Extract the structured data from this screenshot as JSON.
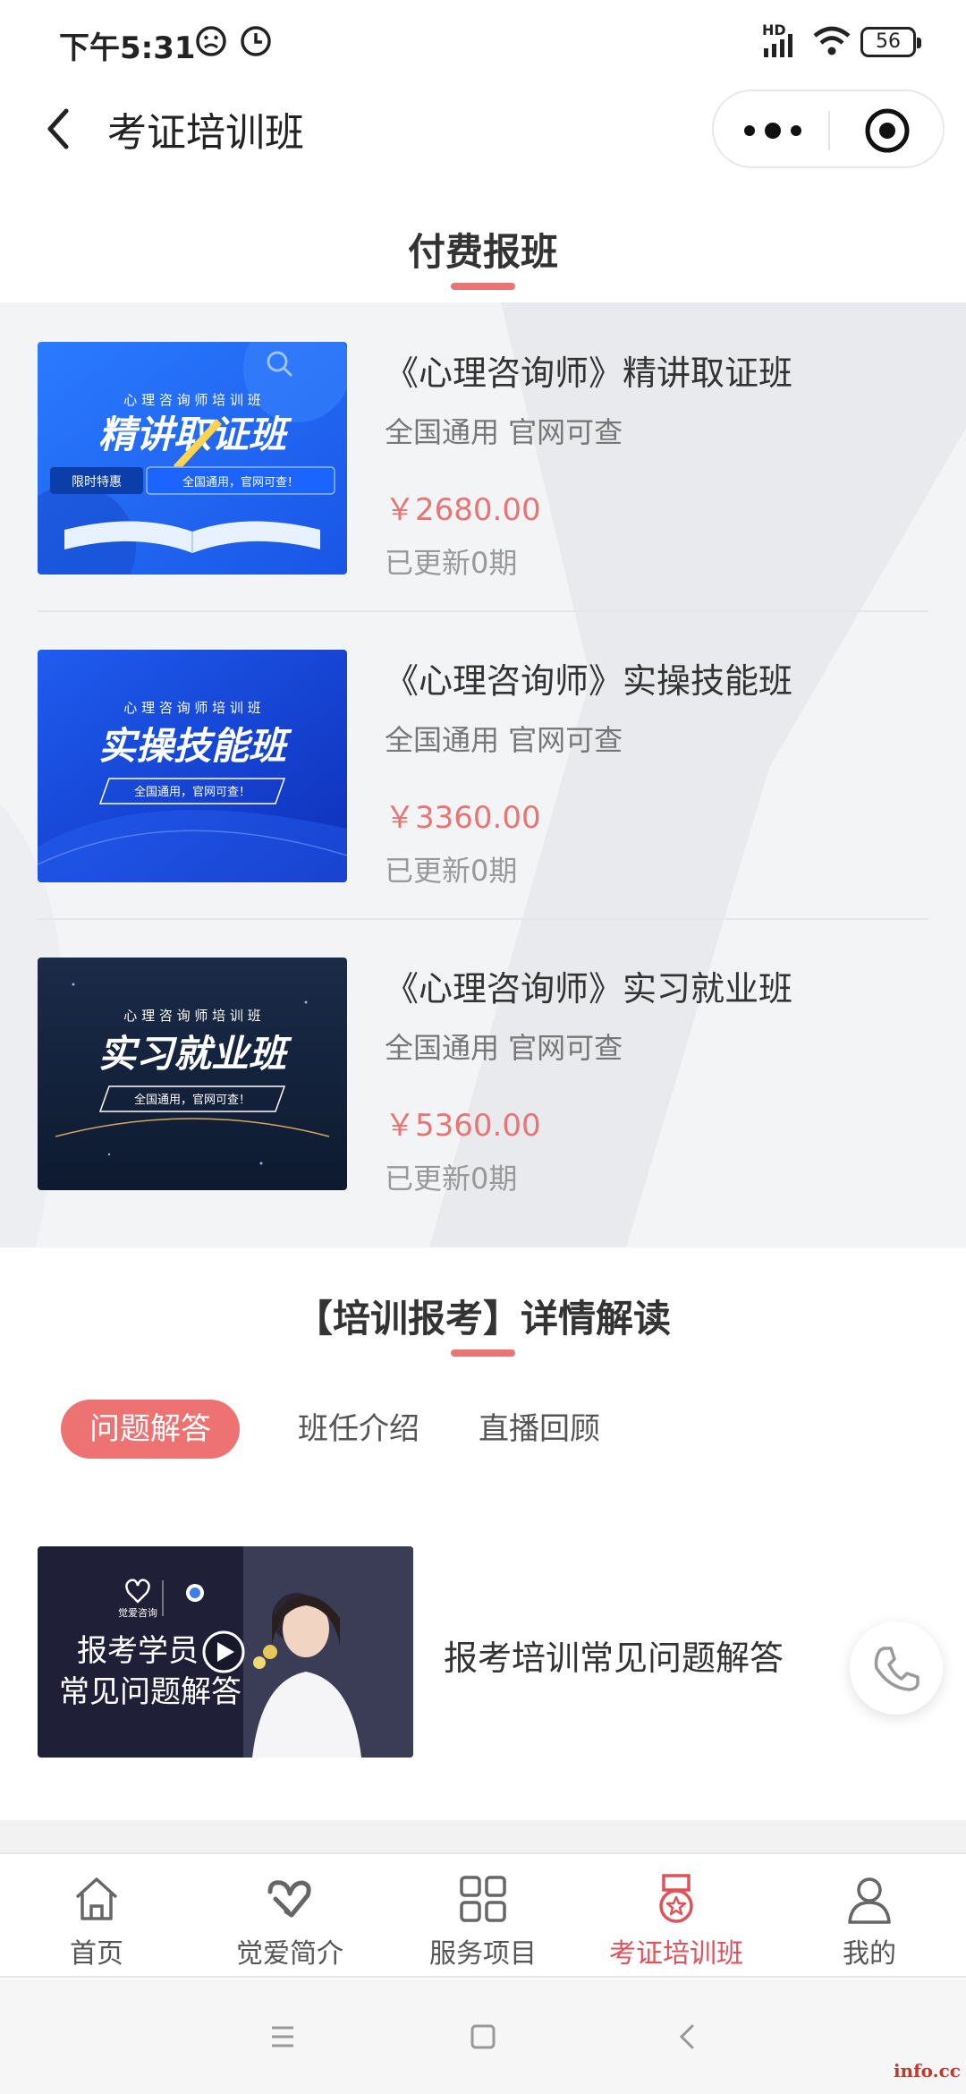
{
  "status_bar": {
    "time": "下午5:31",
    "network": "HD",
    "battery": "56",
    "icons": [
      "face-icon",
      "clock-icon",
      "signal-icon",
      "wifi-icon",
      "battery-icon"
    ]
  },
  "nav": {
    "title": "考证培训班",
    "icons": [
      "back-icon",
      "more-icon",
      "close-mini-program-icon"
    ]
  },
  "paid_section": {
    "heading": "付费报班",
    "courses": [
      {
        "title": "《心理咨询师》精讲取证班",
        "subtitle": "全国通用 官网可查",
        "price": "￥2680.00",
        "updated": "已更新0期",
        "thumb": {
          "top_line": "心 理 咨 询 师 培 训 班",
          "big_text": "精讲取证班",
          "tag_left": "限时特惠",
          "tag_right": "全国通用，官网可查！"
        }
      },
      {
        "title": "《心理咨询师》实操技能班",
        "subtitle": "全国通用 官网可查",
        "price": "￥3360.00",
        "updated": "已更新0期",
        "thumb": {
          "top_line": "心 理 咨 询 师 培 训 班",
          "big_text": "实操技能班",
          "tag": "全国通用，官网可查！"
        }
      },
      {
        "title": "《心理咨询师》实习就业班",
        "subtitle": "全国通用 官网可查",
        "price": "￥5360.00",
        "updated": "已更新0期",
        "thumb": {
          "top_line": "心 理 咨 询 师 培 训 班",
          "big_text": "实习就业班",
          "tag": "全国通用，官网可查！"
        }
      }
    ]
  },
  "detail_section": {
    "heading": "【培训报考】详情解读",
    "tabs": [
      {
        "label": "问题解答",
        "active": true
      },
      {
        "label": "班任介绍",
        "active": false
      },
      {
        "label": "直播回顾",
        "active": false
      }
    ],
    "items": [
      {
        "title": "报考培训常见问题解答",
        "thumb": {
          "brand": "觉爱咨询",
          "line1": "报考学员",
          "line2": "常见问题解答"
        }
      }
    ]
  },
  "tab_bar": {
    "items": [
      {
        "label": "首页",
        "icon": "home-icon",
        "active": false
      },
      {
        "label": "觉爱简介",
        "icon": "heart-logo-icon",
        "active": false
      },
      {
        "label": "服务项目",
        "icon": "grid-icon",
        "active": false
      },
      {
        "label": "考证培训班",
        "icon": "medal-icon",
        "active": true
      },
      {
        "label": "我的",
        "icon": "user-icon",
        "active": false
      }
    ]
  },
  "watermark": "info.cc",
  "colors": {
    "accent": "#ec7372",
    "price": "#e87474",
    "active_tab_label": "#e0515a",
    "course_bg": "#f3f4f6"
  }
}
